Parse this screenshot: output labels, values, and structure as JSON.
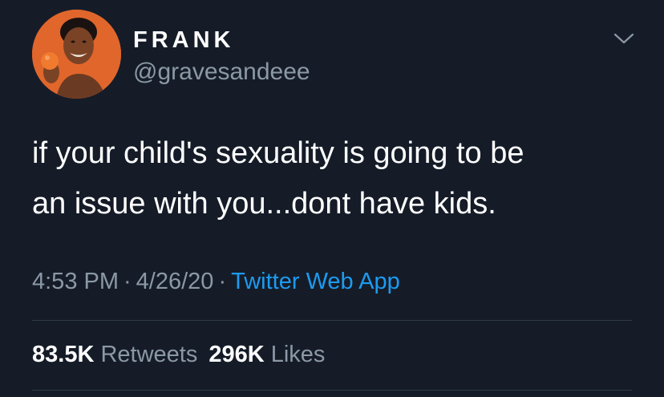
{
  "user": {
    "display_name": "FRANK",
    "handle": "@gravesandeee"
  },
  "tweet": {
    "text_line1": "if your child's sexuality is going to be",
    "text_line2": "an issue with you...dont have kids.",
    "time": "4:53 PM",
    "date": "4/26/20",
    "separator": "·",
    "source": "Twitter Web App"
  },
  "stats": {
    "retweets_count": "83.5K",
    "retweets_label": "Retweets",
    "likes_count": "296K",
    "likes_label": "Likes"
  },
  "icons": {
    "menu": "chevron-down-icon"
  },
  "colors": {
    "background": "#151c28",
    "text": "#ffffff",
    "secondary": "#8b98a5",
    "link": "#1d9bf0",
    "avatar_background": "#e0662c"
  }
}
